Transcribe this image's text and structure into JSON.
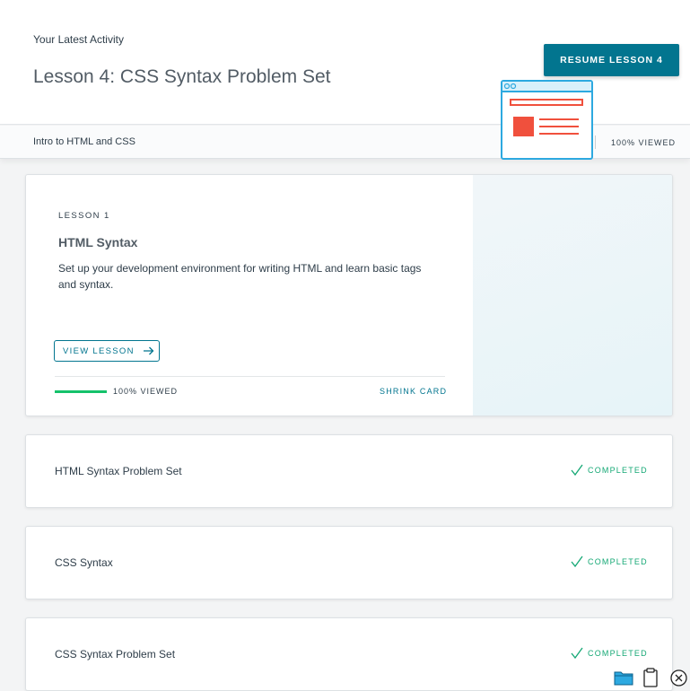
{
  "header": {
    "eyebrow": "Your Latest Activity",
    "title": "Lesson 4: CSS Syntax Problem Set",
    "resume_label": "RESUME LESSON 4"
  },
  "subbar": {
    "course": "Intro to HTML and CSS",
    "viewed": "100% VIEWED"
  },
  "expanded_lesson": {
    "number": "LESSON 1",
    "title": "HTML Syntax",
    "description": "Set up your development environment for writing HTML and learn basic tags and syntax.",
    "view_label": "VIEW LESSON",
    "progress": 1.0,
    "progress_label": "100% VIEWED",
    "shrink_label": "SHRINK CARD",
    "illustration": "browser-window-icon"
  },
  "lessons": [
    {
      "title": "HTML Syntax Problem Set",
      "status": "COMPLETED"
    },
    {
      "title": "CSS Syntax",
      "status": "COMPLETED"
    },
    {
      "title": "CSS Syntax Problem Set",
      "status": "COMPLETED"
    }
  ],
  "colors": {
    "primary": "#02758f",
    "success": "#15c26b",
    "completed": "#15a875",
    "illustration_red": "#f0503d",
    "illustration_blue": "#2da9e0"
  },
  "tray_icons": [
    "folder-icon",
    "clipboard-icon",
    "close-circle-icon"
  ]
}
